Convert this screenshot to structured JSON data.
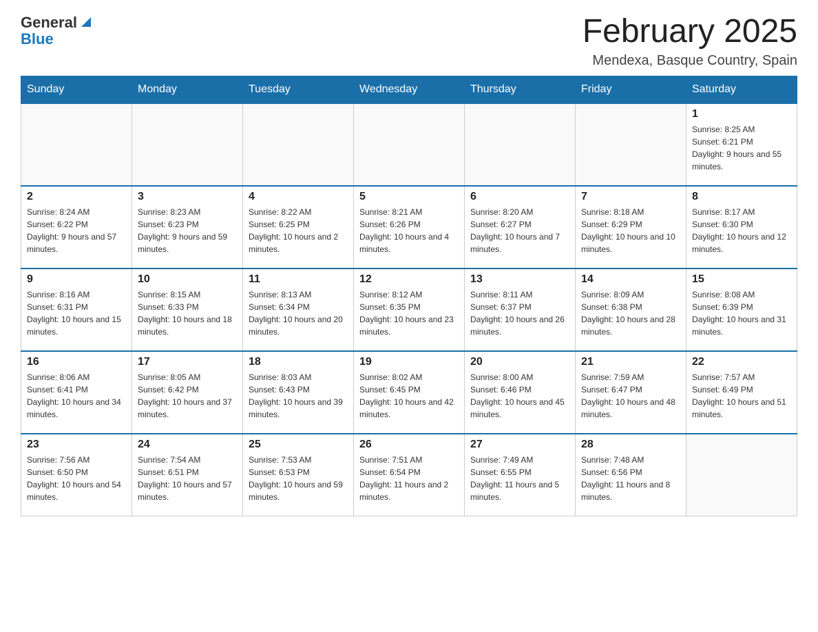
{
  "header": {
    "logo": {
      "general": "General",
      "arrow": "▶",
      "blue": "Blue"
    },
    "title": "February 2025",
    "location": "Mendexa, Basque Country, Spain"
  },
  "days_of_week": [
    "Sunday",
    "Monday",
    "Tuesday",
    "Wednesday",
    "Thursday",
    "Friday",
    "Saturday"
  ],
  "weeks": [
    [
      {
        "day": "",
        "info": ""
      },
      {
        "day": "",
        "info": ""
      },
      {
        "day": "",
        "info": ""
      },
      {
        "day": "",
        "info": ""
      },
      {
        "day": "",
        "info": ""
      },
      {
        "day": "",
        "info": ""
      },
      {
        "day": "1",
        "info": "Sunrise: 8:25 AM\nSunset: 6:21 PM\nDaylight: 9 hours and 55 minutes."
      }
    ],
    [
      {
        "day": "2",
        "info": "Sunrise: 8:24 AM\nSunset: 6:22 PM\nDaylight: 9 hours and 57 minutes."
      },
      {
        "day": "3",
        "info": "Sunrise: 8:23 AM\nSunset: 6:23 PM\nDaylight: 9 hours and 59 minutes."
      },
      {
        "day": "4",
        "info": "Sunrise: 8:22 AM\nSunset: 6:25 PM\nDaylight: 10 hours and 2 minutes."
      },
      {
        "day": "5",
        "info": "Sunrise: 8:21 AM\nSunset: 6:26 PM\nDaylight: 10 hours and 4 minutes."
      },
      {
        "day": "6",
        "info": "Sunrise: 8:20 AM\nSunset: 6:27 PM\nDaylight: 10 hours and 7 minutes."
      },
      {
        "day": "7",
        "info": "Sunrise: 8:18 AM\nSunset: 6:29 PM\nDaylight: 10 hours and 10 minutes."
      },
      {
        "day": "8",
        "info": "Sunrise: 8:17 AM\nSunset: 6:30 PM\nDaylight: 10 hours and 12 minutes."
      }
    ],
    [
      {
        "day": "9",
        "info": "Sunrise: 8:16 AM\nSunset: 6:31 PM\nDaylight: 10 hours and 15 minutes."
      },
      {
        "day": "10",
        "info": "Sunrise: 8:15 AM\nSunset: 6:33 PM\nDaylight: 10 hours and 18 minutes."
      },
      {
        "day": "11",
        "info": "Sunrise: 8:13 AM\nSunset: 6:34 PM\nDaylight: 10 hours and 20 minutes."
      },
      {
        "day": "12",
        "info": "Sunrise: 8:12 AM\nSunset: 6:35 PM\nDaylight: 10 hours and 23 minutes."
      },
      {
        "day": "13",
        "info": "Sunrise: 8:11 AM\nSunset: 6:37 PM\nDaylight: 10 hours and 26 minutes."
      },
      {
        "day": "14",
        "info": "Sunrise: 8:09 AM\nSunset: 6:38 PM\nDaylight: 10 hours and 28 minutes."
      },
      {
        "day": "15",
        "info": "Sunrise: 8:08 AM\nSunset: 6:39 PM\nDaylight: 10 hours and 31 minutes."
      }
    ],
    [
      {
        "day": "16",
        "info": "Sunrise: 8:06 AM\nSunset: 6:41 PM\nDaylight: 10 hours and 34 minutes."
      },
      {
        "day": "17",
        "info": "Sunrise: 8:05 AM\nSunset: 6:42 PM\nDaylight: 10 hours and 37 minutes."
      },
      {
        "day": "18",
        "info": "Sunrise: 8:03 AM\nSunset: 6:43 PM\nDaylight: 10 hours and 39 minutes."
      },
      {
        "day": "19",
        "info": "Sunrise: 8:02 AM\nSunset: 6:45 PM\nDaylight: 10 hours and 42 minutes."
      },
      {
        "day": "20",
        "info": "Sunrise: 8:00 AM\nSunset: 6:46 PM\nDaylight: 10 hours and 45 minutes."
      },
      {
        "day": "21",
        "info": "Sunrise: 7:59 AM\nSunset: 6:47 PM\nDaylight: 10 hours and 48 minutes."
      },
      {
        "day": "22",
        "info": "Sunrise: 7:57 AM\nSunset: 6:49 PM\nDaylight: 10 hours and 51 minutes."
      }
    ],
    [
      {
        "day": "23",
        "info": "Sunrise: 7:56 AM\nSunset: 6:50 PM\nDaylight: 10 hours and 54 minutes."
      },
      {
        "day": "24",
        "info": "Sunrise: 7:54 AM\nSunset: 6:51 PM\nDaylight: 10 hours and 57 minutes."
      },
      {
        "day": "25",
        "info": "Sunrise: 7:53 AM\nSunset: 6:53 PM\nDaylight: 10 hours and 59 minutes."
      },
      {
        "day": "26",
        "info": "Sunrise: 7:51 AM\nSunset: 6:54 PM\nDaylight: 11 hours and 2 minutes."
      },
      {
        "day": "27",
        "info": "Sunrise: 7:49 AM\nSunset: 6:55 PM\nDaylight: 11 hours and 5 minutes."
      },
      {
        "day": "28",
        "info": "Sunrise: 7:48 AM\nSunset: 6:56 PM\nDaylight: 11 hours and 8 minutes."
      },
      {
        "day": "",
        "info": ""
      }
    ]
  ]
}
